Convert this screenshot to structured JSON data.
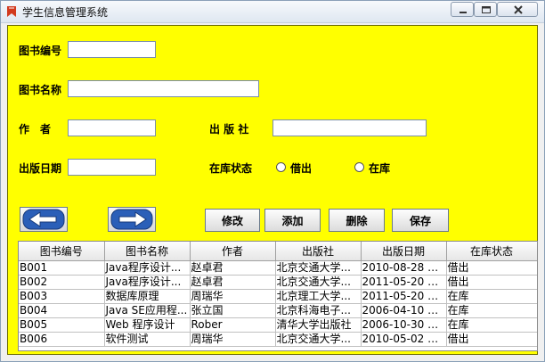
{
  "window": {
    "title": "学生信息管理系统"
  },
  "form": {
    "book_id_label": "图书编号",
    "book_id_value": "",
    "book_name_label": "图书名称",
    "book_name_value": "",
    "author_label": "作　者",
    "author_value": "",
    "publisher_label": "出 版 社",
    "publisher_value": "",
    "pub_date_label": "出版日期",
    "pub_date_value": "",
    "status_label": "在库状态",
    "status_options": [
      "借出",
      "在库"
    ]
  },
  "nav": {
    "prev_icon": "left-arrow-icon",
    "next_icon": "right-arrow-icon"
  },
  "buttons": {
    "modify": "修改",
    "add": "添加",
    "delete": "删除",
    "save": "保存"
  },
  "table": {
    "columns": [
      "图书编号",
      "图书名称",
      "作者",
      "出版社",
      "出版日期",
      "在库状态"
    ],
    "rows": [
      [
        "B001",
        "Java程序设计...",
        "赵卓君",
        "北京交通大学...",
        "2010-08-28 00:...",
        "借出"
      ],
      [
        "B002",
        "Java程序设计...",
        "赵卓君",
        "北京交通大学...",
        "2011-05-20 00:...",
        "借出"
      ],
      [
        "B003",
        "数据库原理",
        "周瑞华",
        "北京理工大学...",
        "2011-05-20 00:...",
        "在库"
      ],
      [
        "B004",
        "Java SE应用程...",
        "张立国",
        "北京科海电子...",
        "2006-04-10 00:...",
        "在库"
      ],
      [
        "B005",
        "Web 程序设计",
        "Rober",
        "清华大学出版社",
        "2006-10-30 00:...",
        "在库"
      ],
      [
        "B006",
        "软件测试",
        "周瑞华",
        "北京交通大学...",
        "2010-05-02 00:...",
        "借出"
      ]
    ]
  }
}
